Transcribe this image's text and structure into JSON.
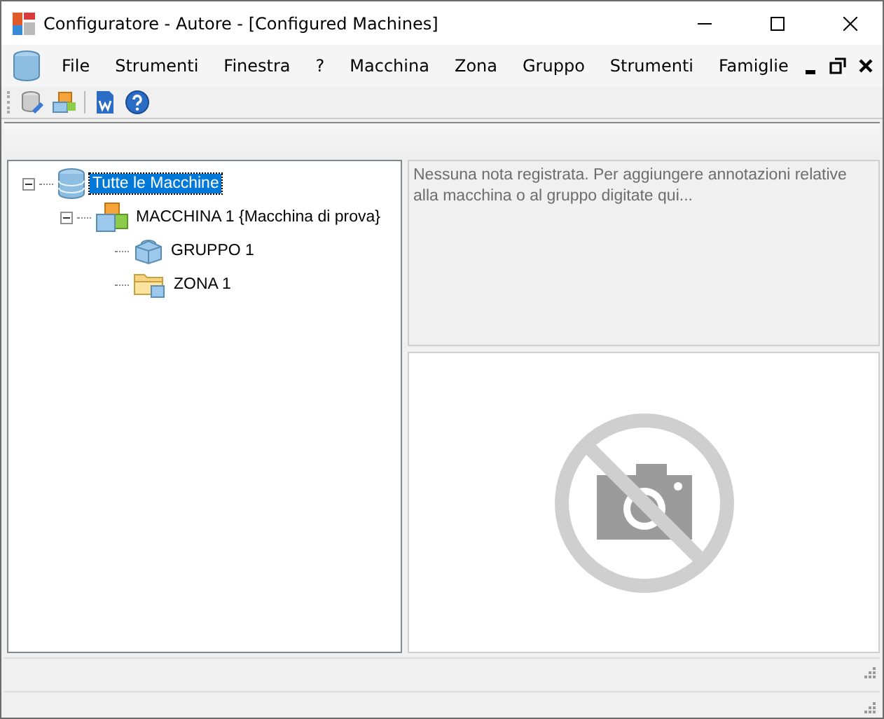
{
  "window": {
    "title": "Configuratore - Autore - [Configured Machines]"
  },
  "menu": [
    "File",
    "Strumenti",
    "Finestra",
    "?",
    "Macchina",
    "Zona",
    "Gruppo",
    "Strumenti",
    "Famiglie"
  ],
  "tree": [
    {
      "label": "Tutte le Macchine",
      "kind": "database",
      "selected": true,
      "expanded": true,
      "children": [
        {
          "label": "MACCHINA 1 {Macchina di prova}",
          "kind": "machine",
          "selected": false,
          "expanded": true,
          "children": [
            {
              "label": "GRUPPO 1",
              "kind": "group",
              "selected": false
            },
            {
              "label": "ZONA 1",
              "kind": "zone",
              "selected": false
            }
          ]
        }
      ]
    }
  ],
  "notes": {
    "text": "Nessuna nota registrata. Per aggiungere annotazioni relative alla macchina o al gruppo digitate qui..."
  }
}
